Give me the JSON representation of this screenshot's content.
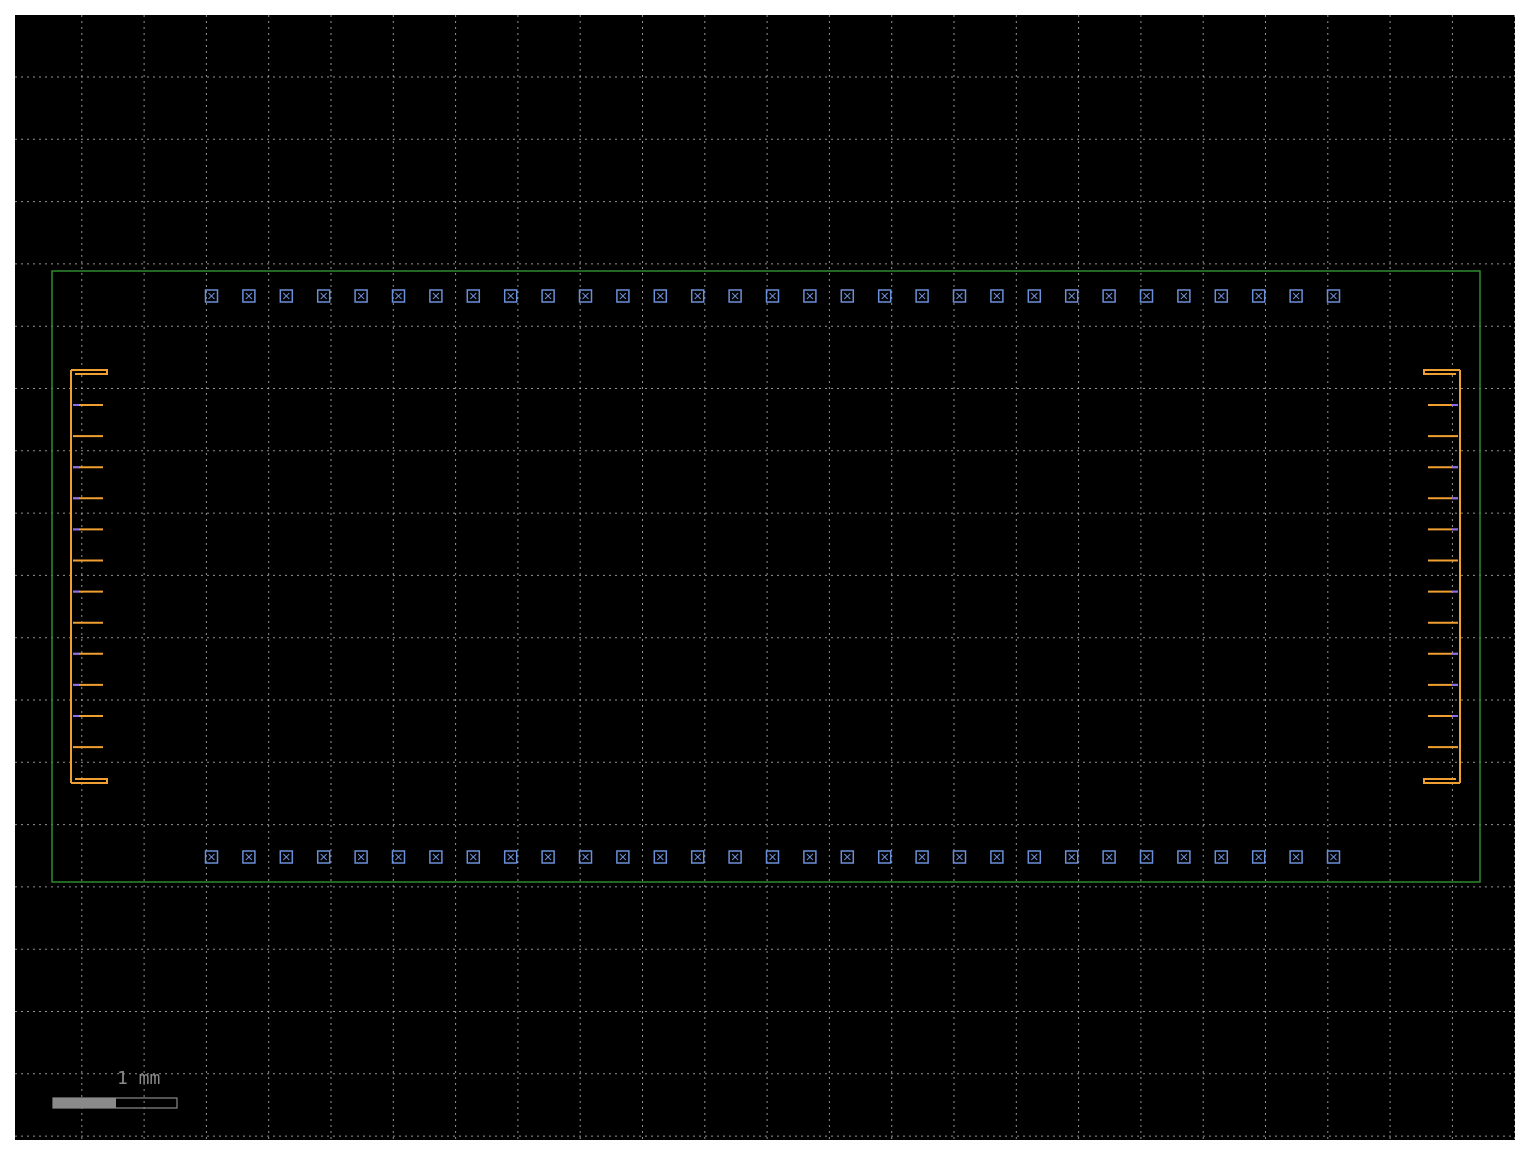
{
  "colors": {
    "background": "#000000",
    "grid": "#b8b8b8",
    "outline": "#2e8b2e",
    "pad": "#6b8fd8",
    "wire": "#f0a030",
    "wire_tip": "#8a6cf0",
    "scale_bar": "#8a8a8a"
  },
  "layout": {
    "top_pads": {
      "count": 31,
      "icon": "square-x-pad-icon"
    },
    "bottom_pads": {
      "count": 31,
      "icon": "square-x-pad-icon"
    },
    "left_comb": {
      "teeth": 12
    },
    "right_comb": {
      "teeth": 12
    }
  },
  "scale": {
    "label": "1 mm"
  }
}
